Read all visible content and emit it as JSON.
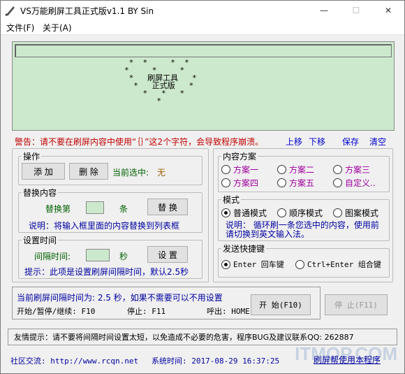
{
  "window": {
    "title": "VS万能刷屏工具正式版v1.1    BY Sin",
    "minimize": "—",
    "maximize": "☐",
    "close": "✕"
  },
  "menu": [
    "文件(F)",
    "关于(A)"
  ],
  "display": {
    "pattern": " *  *     *  *\n*     *     *\n *   刷屏工具   *\n  *   正式版   *\n    *   *   *\n       *"
  },
  "warning": "警告：请不要在刷屏内容中使用“｛｝”这2个字符，会导致程序崩溃。",
  "toplinks": {
    "up": "上移",
    "down": "下移",
    "save": "保存",
    "clear": "清空"
  },
  "ops": {
    "title": "操作",
    "add": "添 加",
    "delete": "删 除",
    "current_label": "当前选中:",
    "current_value": "无"
  },
  "replace": {
    "title": "替换内容",
    "label1": "替换第",
    "label2": "条",
    "button": "替 换",
    "hint": "说明：将输入框里面的内容替换到列表框"
  },
  "interval": {
    "title": "设置时间",
    "label": "间隔时间:",
    "unit": "秒",
    "button": "设 置",
    "hint": "提示：此项是设置刷屏间隔时间，默认2.5秒"
  },
  "scheme": {
    "title": "内容方案",
    "items": [
      "方案一",
      "方案二",
      "方案三",
      "方案四",
      "方案五",
      "自定义.."
    ]
  },
  "mode": {
    "title": "模式",
    "items": [
      "普通模式",
      "顺序模式",
      "图案模式"
    ],
    "hint": "说明：  循环刷一条您选中的内容，使用前请切换到英文输入法。"
  },
  "hotkey": {
    "title": "发送快捷键",
    "items": [
      "Enter 回车键",
      "Ctrl+Enter 组合键"
    ]
  },
  "status": {
    "interval_line": "当前刷屏间隔时间为:  2.5 秒，如果不需要可以不用设置",
    "keys_start": "开始/暂停/继续: F10",
    "keys_stop": "停止: F11",
    "keys_show": "呼出: HOME",
    "start_btn": "开 始(F10)",
    "stop_btn": "停 止(F11)"
  },
  "tip": "友情提示：请不要将间隔时间设置太短，以免造成不必要的危害，程序BUG及建议联系QQ: 262887",
  "footer": {
    "community": "社区交流:  http://www.rcqn.net",
    "time": "系统时间: 2017-08-29 16:37:25",
    "link": "刷屏帮使用本程序"
  },
  "watermark": "ITMOP.COM"
}
